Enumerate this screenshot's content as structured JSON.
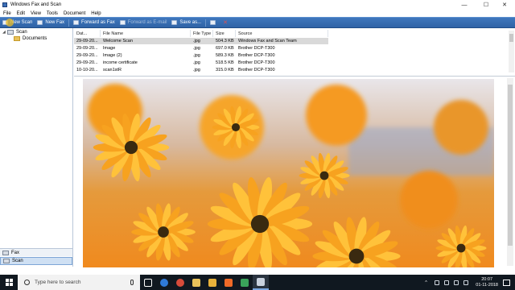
{
  "window": {
    "title": "Windows Fax and Scan",
    "controls": {
      "minimize": "—",
      "maximize": "☐",
      "close": "✕"
    }
  },
  "menu": [
    "File",
    "Edit",
    "View",
    "Tools",
    "Document",
    "Help"
  ],
  "toolbar": {
    "new_scan": "New Scan",
    "new_fax": "New Fax",
    "forward_as_fax": "Forward as Fax",
    "forward_as_email": "Forward as E-mail",
    "save_as": "Save as...",
    "print_icon": "printer-icon",
    "delete_icon": "delete-icon"
  },
  "tree": {
    "root": "Scan",
    "child": "Documents"
  },
  "nav_buttons": {
    "fax": "Fax",
    "scan": "Scan"
  },
  "file_list": {
    "columns": [
      "Dat...",
      "File Name",
      "File Type",
      "Size",
      "Source"
    ],
    "rows": [
      {
        "date": "29-09-20...",
        "name": "Welcome Scan",
        "type": ".jpg",
        "size": "504.3 KB",
        "source": "Windows Fax and Scan Team",
        "selected": true
      },
      {
        "date": "29-09-20...",
        "name": "Image",
        "type": ".jpg",
        "size": "697.0 KB",
        "source": "Brother DCP-T300",
        "selected": false
      },
      {
        "date": "29-09-20...",
        "name": "Image (2)",
        "type": ".jpg",
        "size": "589.3 KB",
        "source": "Brother DCP-T300",
        "selected": false
      },
      {
        "date": "29-09-20...",
        "name": "income certificate",
        "type": ".jpg",
        "size": "518.5 KB",
        "source": "Brother DCP-T300",
        "selected": false
      },
      {
        "date": "10-10-20...",
        "name": "scan1stR",
        "type": ".jpg",
        "size": "315.0 KB",
        "source": "Brother DCP-T300",
        "selected": false
      }
    ]
  },
  "taskbar": {
    "search_placeholder": "Type here to search",
    "time": "20:07",
    "date": "01-11-2018"
  },
  "colors": {
    "toolbar": "#2f63a6",
    "selection": "#d9d9d9",
    "taskbar": "#101820"
  }
}
